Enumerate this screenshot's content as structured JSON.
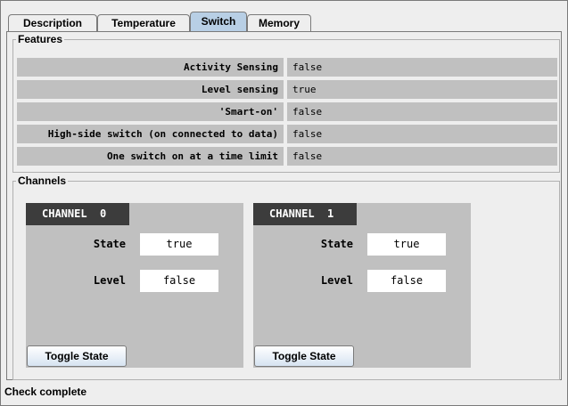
{
  "tabs": [
    {
      "label": "Description",
      "selected": false
    },
    {
      "label": "Temperature",
      "selected": false
    },
    {
      "label": "Switch",
      "selected": true
    },
    {
      "label": "Memory",
      "selected": false
    }
  ],
  "features": {
    "title": "Features",
    "rows": [
      {
        "label": "Activity Sensing",
        "value": "false"
      },
      {
        "label": "Level sensing",
        "value": "true"
      },
      {
        "label": "'Smart-on'",
        "value": "false"
      },
      {
        "label": "High-side switch (on connected to data)",
        "value": "false"
      },
      {
        "label": "One switch on at a time limit",
        "value": "false"
      }
    ]
  },
  "channels": {
    "title": "Channels",
    "items": [
      {
        "header": "CHANNEL  0",
        "state_label": "State",
        "state_value": "true",
        "level_label": "Level",
        "level_value": "false",
        "button_label": "Toggle State"
      },
      {
        "header": "CHANNEL  1",
        "state_label": "State",
        "state_value": "true",
        "level_label": "Level",
        "level_value": "false",
        "button_label": "Toggle State"
      }
    ]
  },
  "status_text": "Check complete",
  "colors": {
    "selected_tab": "#b8cfe5",
    "row_bg": "#c0c0c0",
    "channel_header": "#3c3c3c"
  }
}
